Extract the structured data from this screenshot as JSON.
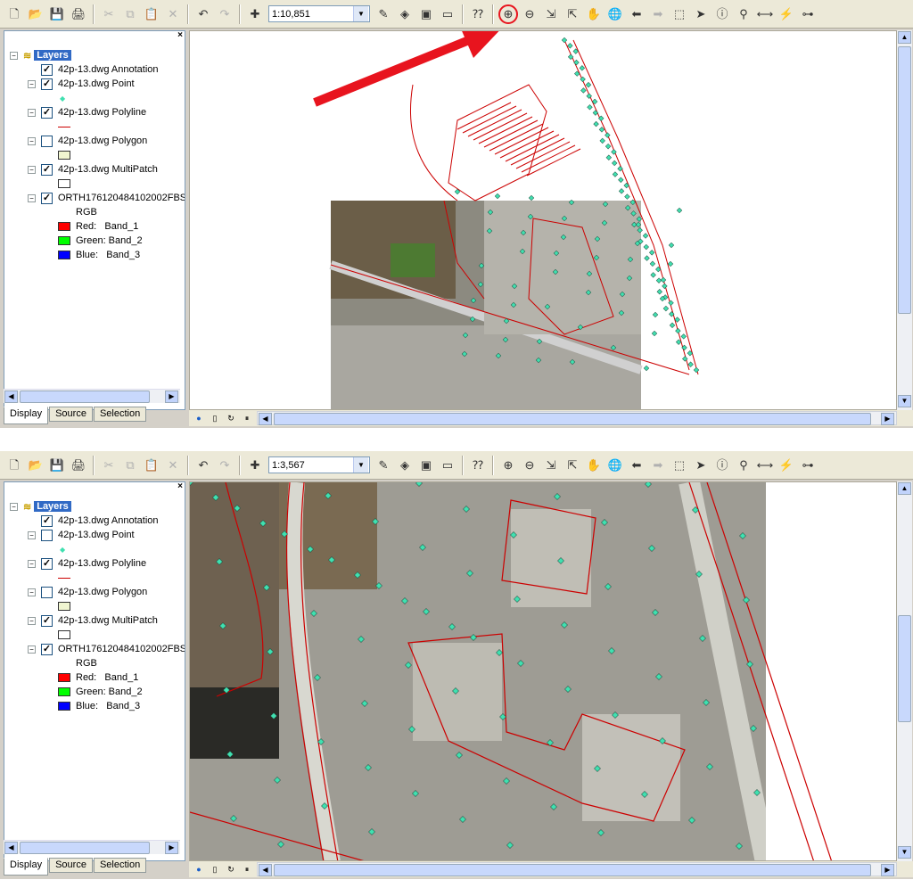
{
  "toolbar_buttons": [
    {
      "name": "new-document-button",
      "icon": "new-document-icon",
      "glyph": "🗋",
      "enabled": true
    },
    {
      "name": "open-button",
      "icon": "open-folder-icon",
      "glyph": "📂",
      "enabled": true
    },
    {
      "name": "save-button",
      "icon": "floppy-disk-icon",
      "glyph": "💾",
      "enabled": true
    },
    {
      "name": "print-button",
      "icon": "printer-icon",
      "glyph": "🖨",
      "enabled": true
    },
    {
      "sep": true
    },
    {
      "name": "cut-button",
      "icon": "scissors-icon",
      "glyph": "✂",
      "enabled": false
    },
    {
      "name": "copy-button",
      "icon": "copy-icon",
      "glyph": "⧉",
      "enabled": false
    },
    {
      "name": "paste-button",
      "icon": "clipboard-icon",
      "glyph": "📋",
      "enabled": true
    },
    {
      "name": "delete-button",
      "icon": "delete-x-icon",
      "glyph": "✕",
      "enabled": false
    },
    {
      "sep": true
    },
    {
      "name": "undo-button",
      "icon": "undo-arrow-icon",
      "glyph": "↶",
      "enabled": true
    },
    {
      "name": "redo-button",
      "icon": "redo-arrow-icon",
      "glyph": "↷",
      "enabled": false
    },
    {
      "sep": true
    },
    {
      "name": "add-data-button",
      "icon": "add-data-plus-icon",
      "glyph": "✚",
      "enabled": true
    },
    {
      "combo": true
    },
    {
      "name": "editor-toolbar-button",
      "icon": "editor-pencil-icon",
      "glyph": "✎",
      "enabled": true
    },
    {
      "name": "arccatalog-button",
      "icon": "arccatalog-icon",
      "glyph": "◈",
      "enabled": true
    },
    {
      "name": "arctoolbox-button",
      "icon": "toolbox-icon",
      "glyph": "▣",
      "enabled": true
    },
    {
      "name": "command-line-button",
      "icon": "command-window-icon",
      "glyph": "▭",
      "enabled": true
    },
    {
      "sep": true
    },
    {
      "name": "whats-this-button",
      "icon": "whats-this-help-icon",
      "glyph": "⁇",
      "enabled": true
    },
    {
      "sep": true
    },
    {
      "name": "zoom-in-button",
      "icon": "zoom-in-magnifier-icon",
      "glyph": "⊕",
      "enabled": true
    },
    {
      "name": "zoom-out-button",
      "icon": "zoom-out-magnifier-icon",
      "glyph": "⊖",
      "enabled": true
    },
    {
      "name": "fixed-zoom-in-button",
      "icon": "fixed-zoom-in-icon",
      "glyph": "⇲",
      "enabled": true
    },
    {
      "name": "fixed-zoom-out-button",
      "icon": "fixed-zoom-out-icon",
      "glyph": "⇱",
      "enabled": true
    },
    {
      "name": "pan-button",
      "icon": "pan-hand-icon",
      "glyph": "✋",
      "enabled": true
    },
    {
      "name": "full-extent-button",
      "icon": "globe-icon",
      "glyph": "🌐",
      "enabled": true
    },
    {
      "name": "previous-extent-button",
      "icon": "arrow-left-icon",
      "glyph": "⬅",
      "enabled": true
    },
    {
      "name": "next-extent-button",
      "icon": "arrow-right-icon",
      "glyph": "➡",
      "enabled": false
    },
    {
      "name": "select-features-button",
      "icon": "select-features-icon",
      "glyph": "⬚",
      "enabled": true
    },
    {
      "name": "select-elements-button",
      "icon": "pointer-arrow-icon",
      "glyph": "➤",
      "enabled": true
    },
    {
      "name": "identify-button",
      "icon": "info-icon",
      "glyph": "ⓘ",
      "enabled": true
    },
    {
      "name": "find-button",
      "icon": "binoculars-icon",
      "glyph": "⚲",
      "enabled": true
    },
    {
      "name": "measure-button",
      "icon": "measure-ruler-icon",
      "glyph": "⟷",
      "enabled": true
    },
    {
      "name": "hyperlink-button",
      "icon": "lightning-bolt-icon",
      "glyph": "⚡",
      "enabled": false
    },
    {
      "name": "network-button",
      "icon": "network-tree-icon",
      "glyph": "⊶",
      "enabled": true
    }
  ],
  "panes": [
    {
      "scale": "1:10,851",
      "toc": {
        "root_label": "Layers",
        "layers": [
          {
            "label": "42p-13.dwg Annotation",
            "checked": true,
            "expandable": false
          },
          {
            "label": "42p-13.dwg Point",
            "checked": true,
            "expandable": true
          },
          {
            "label": "42p-13.dwg Polyline",
            "checked": true,
            "expandable": true
          },
          {
            "label": "42p-13.dwg Polygon",
            "checked": false,
            "expandable": true
          },
          {
            "label": "42p-13.dwg MultiPatch",
            "checked": true,
            "expandable": true
          },
          {
            "label": "ORTH176120484102002FBS",
            "checked": true,
            "expandable": true
          }
        ],
        "rgb_label": "RGB",
        "bands": [
          {
            "label": "Red:   Band_1",
            "color": "#ff0000"
          },
          {
            "label": "Green: Band_2",
            "color": "#00ff00"
          },
          {
            "label": "Blue:   Band_3",
            "color": "#0000ff"
          }
        ]
      },
      "tabs": [
        "Display",
        "Source",
        "Selection"
      ],
      "active_tab": 0,
      "annotated_button": "zoom-in-button"
    },
    {
      "scale": "1:3,567",
      "toc": {
        "root_label": "Layers",
        "layers": [
          {
            "label": "42p-13.dwg Annotation",
            "checked": true,
            "expandable": false
          },
          {
            "label": "42p-13.dwg Point",
            "checked": false,
            "expandable": true
          },
          {
            "label": "42p-13.dwg Polyline",
            "checked": true,
            "expandable": true
          },
          {
            "label": "42p-13.dwg Polygon",
            "checked": false,
            "expandable": true
          },
          {
            "label": "42p-13.dwg MultiPatch",
            "checked": true,
            "expandable": true
          },
          {
            "label": "ORTH176120484102002FBS",
            "checked": true,
            "expandable": true
          }
        ],
        "rgb_label": "RGB",
        "bands": [
          {
            "label": "Red:   Band_1",
            "color": "#ff0000"
          },
          {
            "label": "Green: Band_2",
            "color": "#00ff00"
          },
          {
            "label": "Blue:   Band_3",
            "color": "#0000ff"
          }
        ]
      },
      "tabs": [
        "Display",
        "Source",
        "Selection"
      ],
      "active_tab": 0
    }
  ],
  "colors": {
    "polyline": "#cc0000",
    "point": "#40e0b0",
    "polygon_fill": "#f0f5d0",
    "annotation_arrow": "#e8141e",
    "selection_highlight": "#316ac5"
  }
}
